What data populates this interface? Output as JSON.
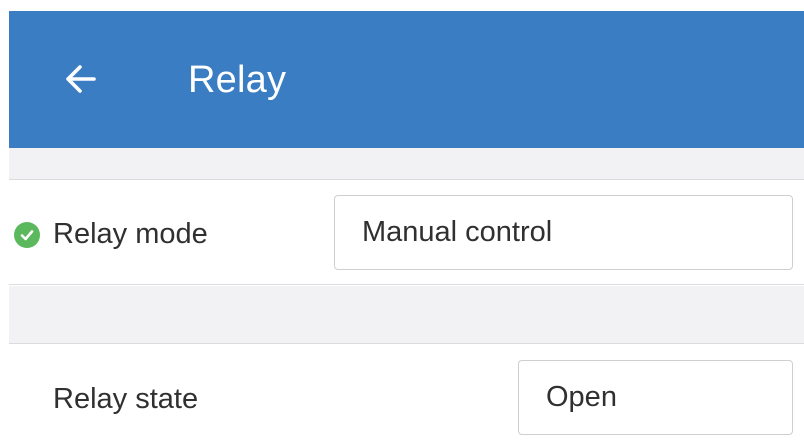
{
  "app_bar": {
    "title": "Relay",
    "back_icon": "arrow-left-icon",
    "background_color": "#3a7dc3"
  },
  "settings": {
    "relay_mode": {
      "label": "Relay mode",
      "value": "Manual control",
      "status_icon": "check-circle-icon",
      "status_color": "#5cb85c"
    },
    "relay_state": {
      "label": "Relay state",
      "value": "Open"
    }
  }
}
